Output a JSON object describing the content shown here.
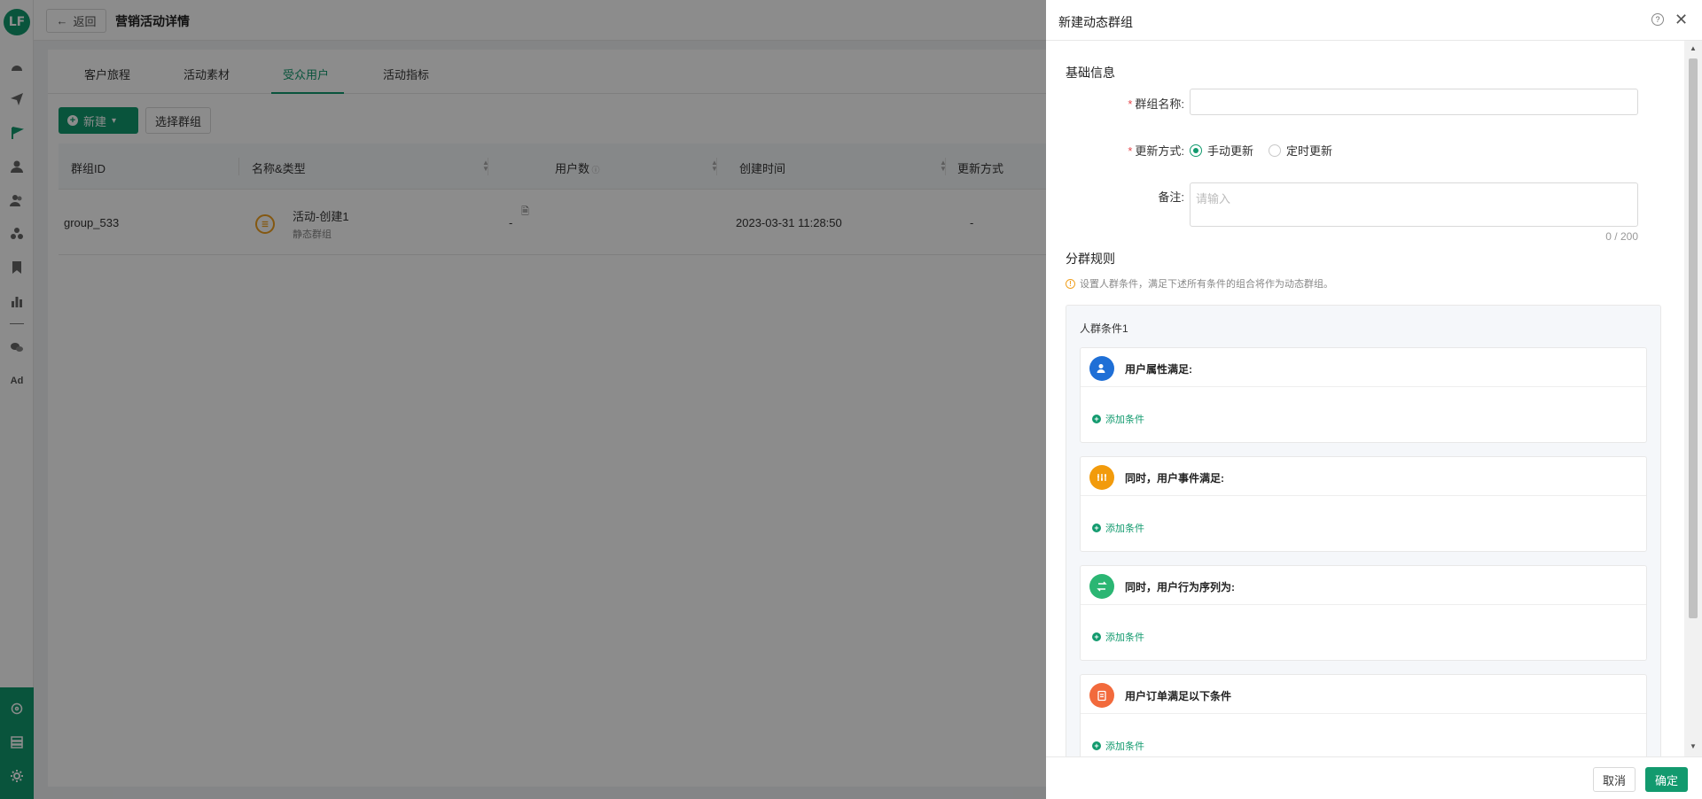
{
  "app": {
    "logo_text": "LF",
    "back_label": "返回",
    "page_title": "营销活动详情"
  },
  "rail": {
    "ad_label": "Ad"
  },
  "tabs": [
    {
      "label": "客户旅程"
    },
    {
      "label": "活动素材"
    },
    {
      "label": "受众用户"
    },
    {
      "label": "活动指标"
    }
  ],
  "toolbar": {
    "new_label": "新建",
    "select_group_label": "选择群组"
  },
  "table": {
    "columns": [
      "群组ID",
      "名称&类型",
      "用户数",
      "创建时间",
      "更新方式"
    ],
    "rows": [
      {
        "id": "group_533",
        "name": "活动-创建1",
        "type": "静态群组",
        "users": "-",
        "created": "2023-03-31 11:28:50",
        "update_mode": "-"
      }
    ]
  },
  "drawer": {
    "title": "新建动态群组",
    "basic_section": "基础信息",
    "group_name_label": "群组名称:",
    "group_name_value": "",
    "update_mode_label": "更新方式:",
    "update_options": [
      "手动更新",
      "定时更新"
    ],
    "update_selected": "手动更新",
    "remark_label": "备注:",
    "remark_placeholder": "请输入",
    "remark_counter": "0 / 200",
    "rules_section": "分群规则",
    "rules_hint": "设置人群条件，满足下述所有条件的组合将作为动态群组。",
    "condition_group_title": "人群条件1",
    "cards": [
      {
        "title": "用户属性满足:",
        "color": "#1f6fd6",
        "add_label": "添加条件"
      },
      {
        "title": "同时，用户事件满足:",
        "color": "#f29b0c",
        "add_label": "添加条件"
      },
      {
        "title": "同时，用户行为序列为:",
        "color": "#2bb673",
        "add_label": "添加条件"
      },
      {
        "title": "用户订单满足以下条件",
        "color": "#f26a3c",
        "add_label": "添加条件"
      }
    ],
    "cancel_label": "取消",
    "ok_label": "确定"
  },
  "colors": {
    "brand": "#129a6e"
  }
}
